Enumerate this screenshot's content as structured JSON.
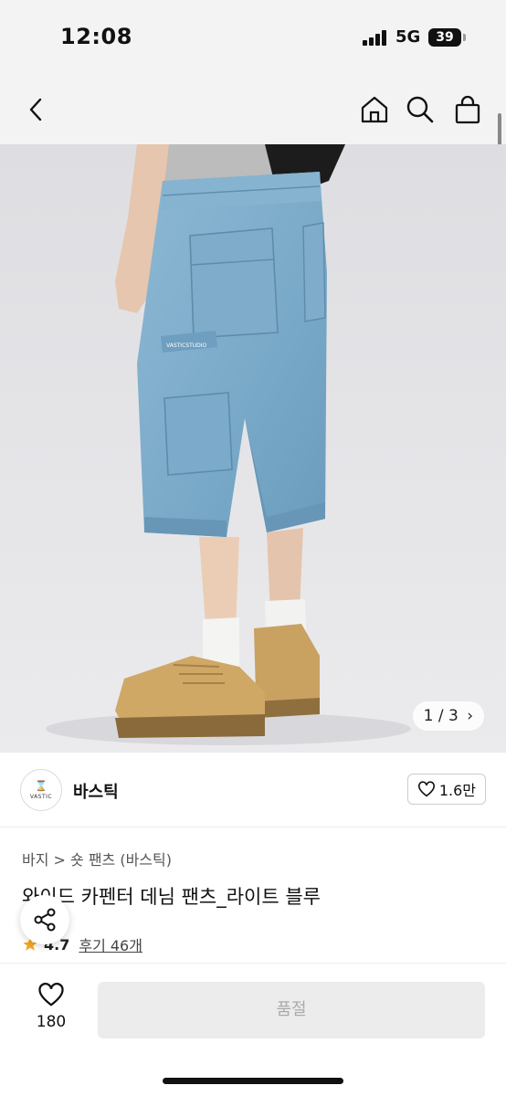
{
  "status": {
    "time": "12:08",
    "network": "5G",
    "battery": "39"
  },
  "image": {
    "page_counter": "1 / 3",
    "chevron": "›",
    "tag": "VASTICSTUDIO"
  },
  "brand": {
    "name": "바스틱",
    "logo_mark": "⌛",
    "logo_text": "VASTIC",
    "like_count": "1.6만"
  },
  "product": {
    "breadcrumb": "바지 > 숏 팬츠 (바스틱)",
    "title": "와이드 카펜터 데님 팬츠_라이트 블루",
    "rating": "4.7",
    "reviews": "후기 46개"
  },
  "bottom": {
    "wish_count": "180",
    "buy_label": "품절"
  },
  "icons": [
    "back-icon",
    "home-icon",
    "search-icon",
    "shopping-bag-icon",
    "heart-icon",
    "share-icon",
    "star-icon"
  ],
  "colors": {
    "denim": "#7aaac8",
    "shoe": "#c9a161",
    "background": "#e6e6e8",
    "disabled": "#ececec",
    "star": "#f5a623"
  }
}
